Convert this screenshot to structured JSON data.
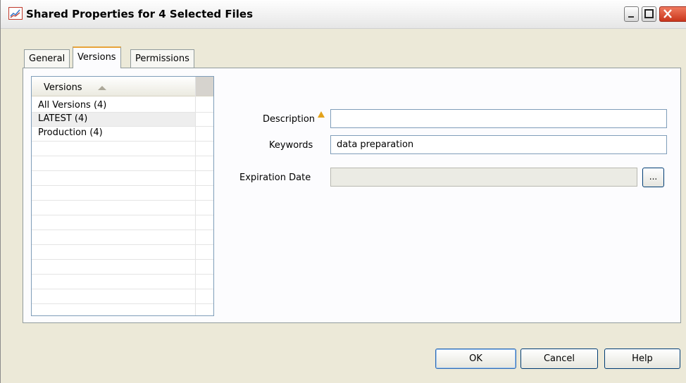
{
  "window": {
    "title": "Shared Properties for 4 Selected Files"
  },
  "tabs": [
    {
      "label": "General",
      "active": false
    },
    {
      "label": "Versions",
      "active": true
    },
    {
      "label": "Permissions",
      "active": false
    }
  ],
  "versions_list": {
    "header": "Versions",
    "sort": "ascending",
    "items": [
      "All Versions (4)",
      "LATEST (4)",
      "Production (4)"
    ],
    "selected_index": 1
  },
  "form": {
    "description_label": "Description",
    "description_value": "",
    "keywords_label": "Keywords",
    "keywords_value": "data preparation",
    "expiration_label": "Expiration Date",
    "expiration_value": "",
    "browse_label": "..."
  },
  "buttons": {
    "ok": "OK",
    "cancel": "Cancel",
    "help": "Help"
  },
  "colors": {
    "accent_tab": "#e8a33a",
    "close_button": "#c9361c",
    "warning_icon": "#e3a21a"
  }
}
